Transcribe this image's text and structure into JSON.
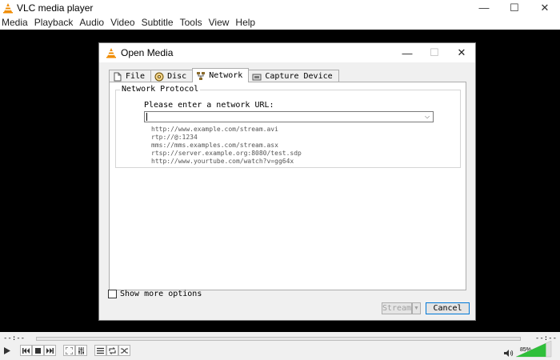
{
  "app": {
    "title": "VLC media player"
  },
  "window_controls": {
    "minimize": "—",
    "maximize": "☐",
    "close": "✕"
  },
  "menu": [
    "Media",
    "Playback",
    "Audio",
    "Video",
    "Subtitle",
    "Tools",
    "View",
    "Help"
  ],
  "dialog": {
    "title": "Open Media",
    "tabs": [
      {
        "label": "File",
        "icon": "file-icon"
      },
      {
        "label": "Disc",
        "icon": "disc-icon"
      },
      {
        "label": "Network",
        "icon": "network-icon",
        "active": true
      },
      {
        "label": "Capture Device",
        "icon": "capture-device-icon"
      }
    ],
    "group_title": "Network Protocol",
    "prompt": "Please enter a network URL:",
    "url_value": "",
    "examples": [
      "http://www.example.com/stream.avi",
      "rtp://@:1234",
      "mms://mms.examples.com/stream.asx",
      "rtsp://server.example.org:8080/test.sdp",
      "http://www.yourtube.com/watch?v=gg64x"
    ],
    "more_options": "Show more options",
    "stream_button": "Stream",
    "cancel_button": "Cancel"
  },
  "playback": {
    "time_elapsed": "--:--",
    "time_total": "--:--",
    "volume_percent": 85,
    "volume_label": "85%"
  },
  "colors": {
    "accent": "#0078d7",
    "vlc_orange": "#f08c00",
    "volume_green": "#2fbf3a"
  }
}
